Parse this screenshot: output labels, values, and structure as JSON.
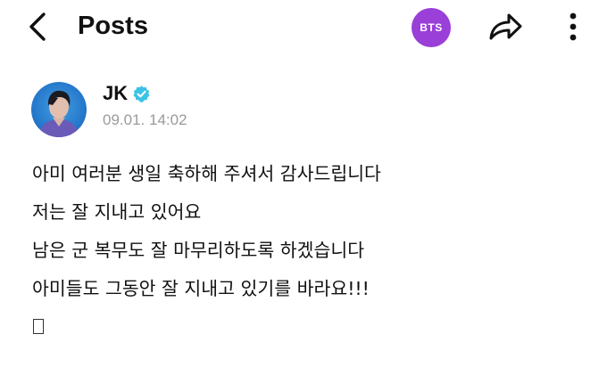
{
  "header": {
    "title": "Posts",
    "back_icon": "chevron-left-icon",
    "badge_label": "BTS",
    "badge_color": "#9a3fd8",
    "share_icon": "share-arrow-icon",
    "more_icon": "more-vertical-icon"
  },
  "author": {
    "name": "JK",
    "verified_icon": "verified-badge-icon",
    "verified_color": "#3cc2e6",
    "timestamp": "09.01. 14:02"
  },
  "post": {
    "lines": [
      "아미 여러분 생일 축하해 주셔서 감사드립니다",
      "저는 잘 지내고 있어요",
      "남은 군 복무도 잘 마무리하도록 하겠습니다",
      "아미들도 그동안 잘 지내고 있기를 바라요!!!"
    ],
    "trailing_glyph": "missing-emoji-box"
  }
}
